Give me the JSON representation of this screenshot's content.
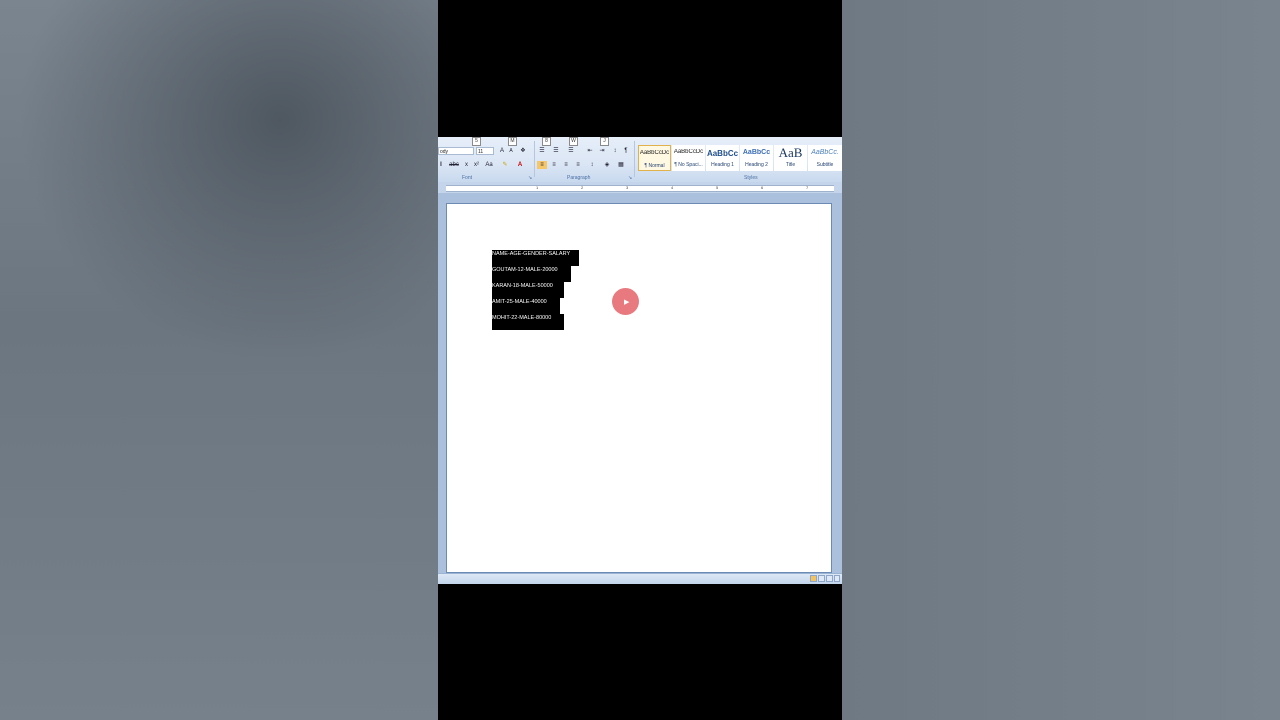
{
  "ribbon": {
    "font_name": "Calibri (Body)",
    "font_name_visible": "ody",
    "font_size": "11",
    "group_font_label": "Font",
    "group_paragraph_label": "Paragraph",
    "group_styles_label": "Styles",
    "keytips": [
      "5",
      "M",
      "8",
      "W",
      "J"
    ],
    "styles": [
      {
        "sample": "AaBbCcDc",
        "name": "¶ Normal",
        "selected": true
      },
      {
        "sample": "AaBbCcDc",
        "name": "¶ No Spaci...",
        "selected": false
      },
      {
        "sample": "AaBbCc",
        "name": "Heading 1",
        "selected": false
      },
      {
        "sample": "AaBbCc",
        "name": "Heading 2",
        "selected": false
      },
      {
        "sample": "AaB",
        "name": "Title",
        "selected": false
      },
      {
        "sample": "AaBbCc.",
        "name": "Subtitle",
        "selected": false
      }
    ]
  },
  "ruler": {
    "numbers": [
      "1",
      "2",
      "3",
      "4",
      "5",
      "6",
      "7"
    ]
  },
  "document": {
    "lines": [
      "NAME-AGE-GENDER-SALARY",
      "GOUTAM-12-MALE-20000",
      "KARAN-18-MALE-50000",
      "AMIT-25-MALE-40000",
      "MOHIT-22-MALE-80000"
    ]
  },
  "colors": {
    "selection_bg": "#000000",
    "selection_text": "#ffffff",
    "cursor_highlight": "#e66a70",
    "ribbon_bg": "#dbe6f5"
  }
}
